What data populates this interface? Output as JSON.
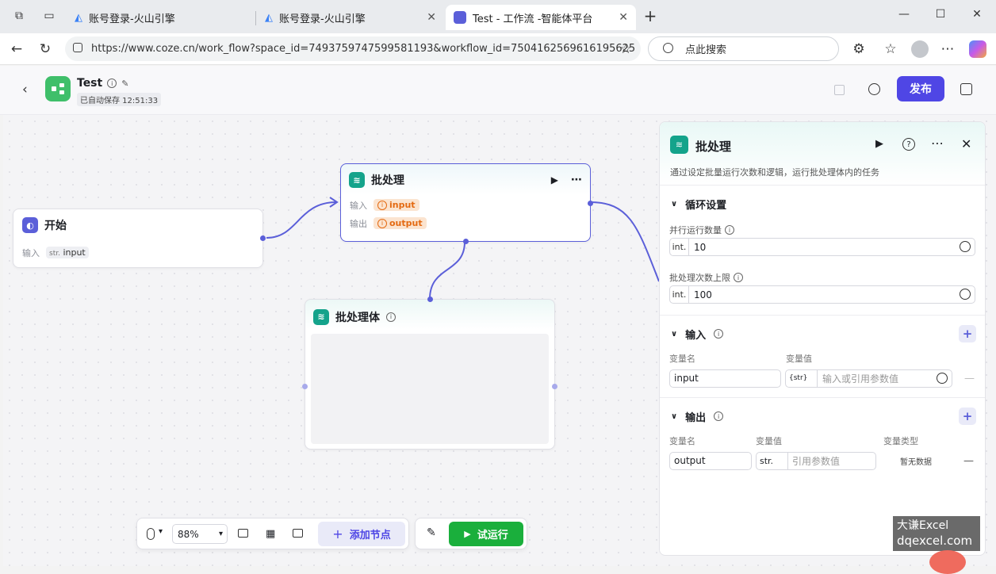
{
  "browser": {
    "tabs": [
      {
        "title": "账号登录-火山引擎"
      },
      {
        "title": "账号登录-火山引擎"
      },
      {
        "title": "Test - 工作流 -智能体平台"
      }
    ],
    "url": "https://www.coze.cn/work_flow?space_id=7493759747599581193&workflow_id=7504162569616195625",
    "search_placeholder": "点此搜索"
  },
  "header": {
    "title": "Test",
    "autosave": "已自动保存 12:51:33",
    "publish_label": "发布"
  },
  "nodes": {
    "start": {
      "title": "开始",
      "input_label": "输入",
      "input_type": "str.",
      "input_name": "input"
    },
    "batch": {
      "title": "批处理",
      "input_label": "输入",
      "output_label": "输出",
      "input_var": "input",
      "output_var": "output"
    },
    "batch_body": {
      "title": "批处理体"
    }
  },
  "panel": {
    "title": "批处理",
    "description": "通过设定批量运行次数和逻辑，运行批处理体内的任务",
    "loop_section": "循环设置",
    "parallel_label": "并行运行数量",
    "parallel_type": "int.",
    "parallel_value": "10",
    "limit_label": "批处理次数上限",
    "limit_type": "int.",
    "limit_value": "100",
    "input_section": "输入",
    "input_col_name": "变量名",
    "input_col_value": "变量值",
    "input_var_name": "input",
    "input_var_type": "{str}",
    "input_placeholder": "输入或引用参数值",
    "output_section": "输出",
    "output_col_name": "变量名",
    "output_col_value": "变量值",
    "output_col_type": "变量类型",
    "output_var_name": "output",
    "output_var_type": "str.",
    "output_placeholder": "引用参数值",
    "output_no_data": "暂无数据"
  },
  "toolbar": {
    "zoom": "88%",
    "add_node": "添加节点",
    "test_run": "试运行"
  },
  "watermark": {
    "line1": "大谦Excel",
    "line2": "dqexcel.com"
  },
  "colors": {
    "accent": "#5b5fd9",
    "run_green": "#1aaf3c",
    "teal": "#14a38b"
  }
}
